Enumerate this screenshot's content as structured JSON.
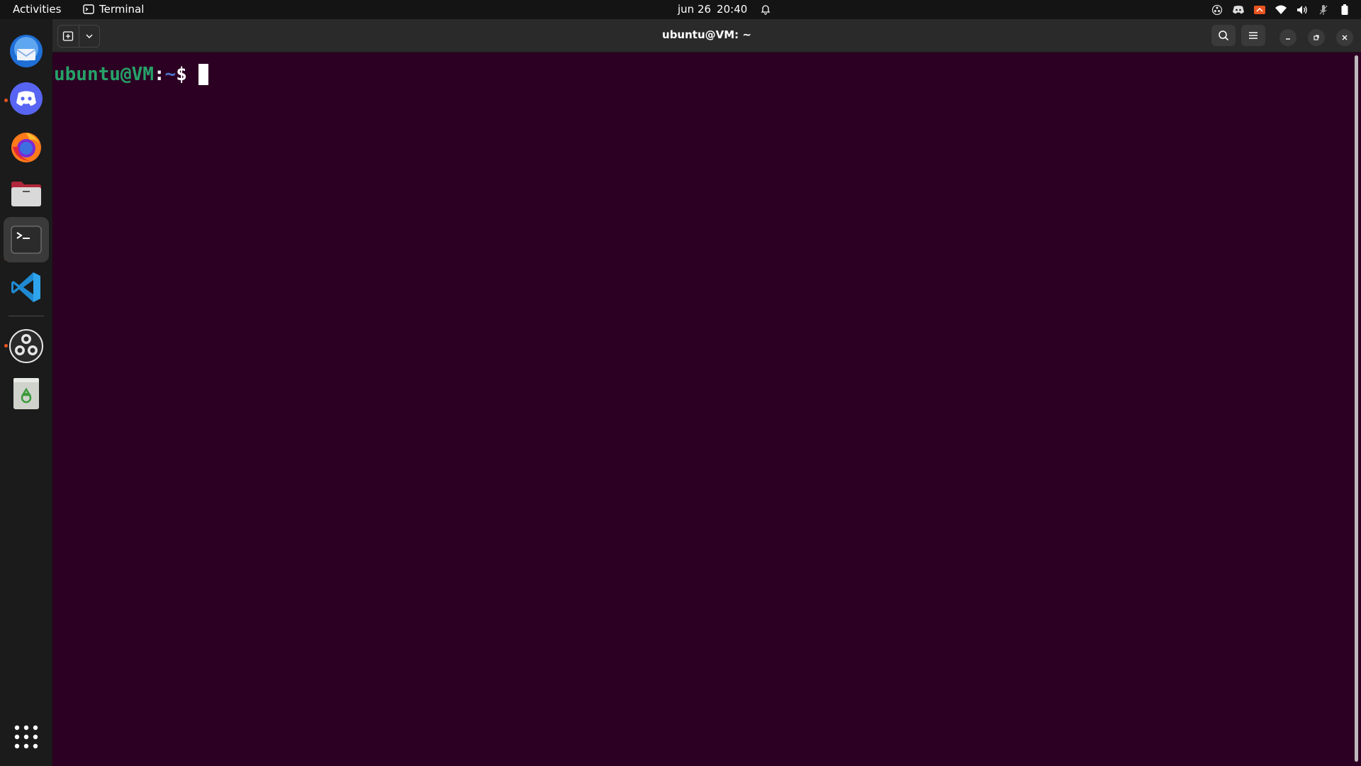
{
  "topbar": {
    "activities_label": "Activities",
    "app_name": "Terminal",
    "date": "jun 26",
    "time": "20:40"
  },
  "dock": {
    "items": [
      {
        "name": "thunderbird",
        "running": false
      },
      {
        "name": "discord",
        "running": true
      },
      {
        "name": "firefox",
        "running": false
      },
      {
        "name": "files",
        "running": false
      },
      {
        "name": "terminal",
        "running": true,
        "active": true
      },
      {
        "name": "vscode",
        "running": false
      },
      {
        "name": "obs-studio",
        "running": true
      },
      {
        "name": "trash",
        "running": false
      }
    ]
  },
  "window": {
    "title": "ubuntu@VM: ~"
  },
  "terminal": {
    "prompt_user": "ubuntu@VM",
    "prompt_colon": ":",
    "prompt_path": "~",
    "prompt_symbol": "$"
  },
  "colors": {
    "terminal_bg": "#2c0022",
    "prompt_user": "#26a269",
    "prompt_path": "#4a74c9",
    "accent": "#e95420"
  }
}
